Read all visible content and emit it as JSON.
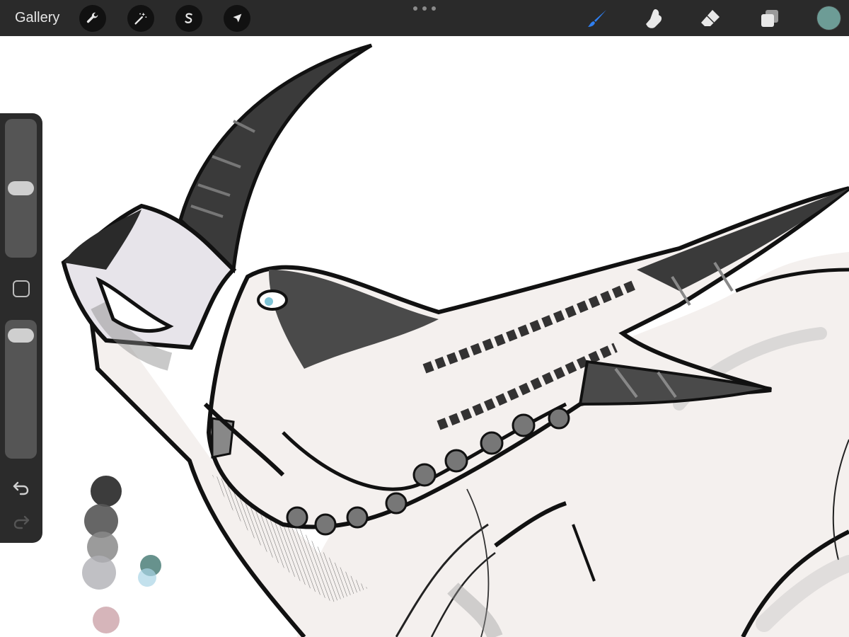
{
  "toolbar": {
    "gallery_label": "Gallery",
    "actions_tools": [
      {
        "name": "actions",
        "icon": "wrench-icon"
      },
      {
        "name": "adjustments",
        "icon": "magic-wand-icon"
      },
      {
        "name": "selection",
        "icon": "selection-s-icon"
      },
      {
        "name": "transform",
        "icon": "arrow-cursor-icon"
      }
    ],
    "more_menu_icon": "ellipsis-icon",
    "drawing_tools": [
      {
        "name": "brush",
        "icon": "brush-icon",
        "active": true
      },
      {
        "name": "smudge",
        "icon": "smudge-finger-icon",
        "active": false
      },
      {
        "name": "eraser",
        "icon": "eraser-icon",
        "active": false
      },
      {
        "name": "layers",
        "icon": "layers-icon",
        "active": false
      }
    ],
    "current_color": "#6d9c96"
  },
  "sidebar": {
    "brush_size_level": 0.5,
    "opacity_level": 0.95,
    "modifier_icon": "square-modifier-icon",
    "undo_icon": "undo-arrow-icon",
    "redo_icon": "redo-arrow-icon",
    "redo_enabled": false
  },
  "colors": {
    "toolbar_bg": "#2a2a2a",
    "accent_active": "#2f7ff0",
    "ink": "#111111",
    "paper": "#f4f0ee",
    "palette_blobs": [
      "#2b2b2b",
      "#555555",
      "#8a8a8a",
      "#b0b0b5",
      "#cfa8ae",
      "#5f8c87",
      "#a9d4e6"
    ]
  }
}
